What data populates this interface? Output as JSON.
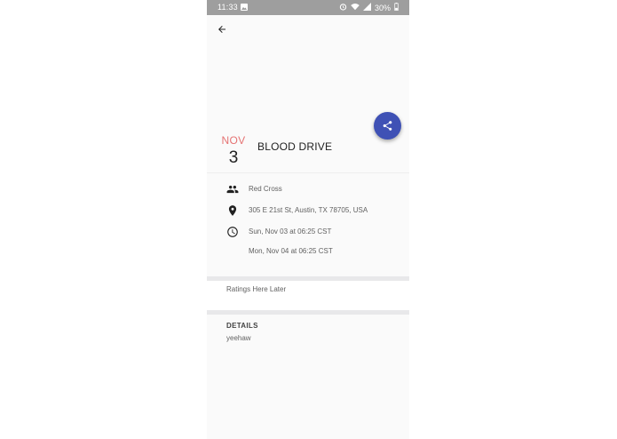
{
  "status_bar": {
    "time": "11:33",
    "battery": "30%"
  },
  "event": {
    "month": "NOV",
    "day": "3",
    "title": "BLOOD DRIVE"
  },
  "info": {
    "organizer": "Red Cross",
    "address": "305 E 21st St, Austin, TX 78705, USA",
    "start_time": "Sun,  Nov 03 at 06:25  CST",
    "end_time": "Mon,  Nov 04 at 06:25  CST"
  },
  "ratings": {
    "placeholder": "Ratings Here Later"
  },
  "details": {
    "header": "DETAILS",
    "body": "yeehaw"
  },
  "icons": {
    "back": "arrow-back-icon",
    "share": "share-icon",
    "organizer": "people-icon",
    "location": "location-pin-icon",
    "time": "clock-icon"
  },
  "colors": {
    "accent": "#3f51b5",
    "month": "#e57373",
    "statusbar": "#9e9e9e"
  }
}
